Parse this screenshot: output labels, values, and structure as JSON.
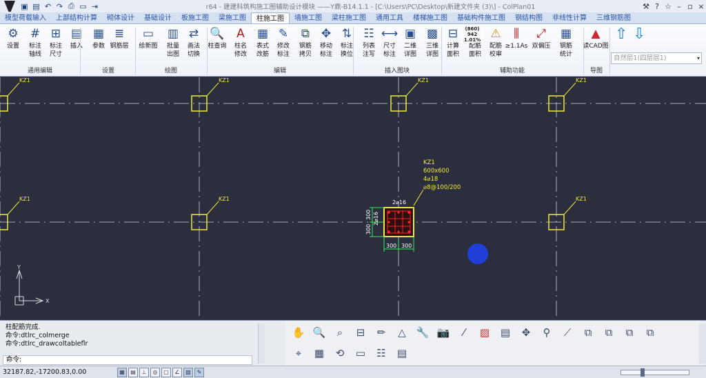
{
  "titlebar": {
    "title": "r64 - 建建科筑构施工图辅助设计模块 ——Y鼎-B14.1.1 - [C:\\Users\\PC\\Desktop\\新建文件夹 (3)\\] - ColPlan01",
    "quick_access": [
      "save-icon",
      "undo-icon",
      "redo-icon",
      "print-icon",
      "open-icon",
      "export-icon"
    ]
  },
  "tabs": [
    {
      "label": "模型荷载输入",
      "active": false
    },
    {
      "label": "上部结构计算",
      "active": false
    },
    {
      "label": "砌体设计",
      "active": false
    },
    {
      "label": "基础设计",
      "active": false
    },
    {
      "label": "板施工图",
      "active": false
    },
    {
      "label": "梁施工图",
      "active": false
    },
    {
      "label": "柱施工图",
      "active": true
    },
    {
      "label": "墙施工图",
      "active": false
    },
    {
      "label": "梁柱施工图",
      "active": false
    },
    {
      "label": "通用工具",
      "active": false
    },
    {
      "label": "楼梯施工图",
      "active": false
    },
    {
      "label": "基础构件施工图",
      "active": false
    },
    {
      "label": "钢结构图",
      "active": false
    },
    {
      "label": "非线性计算",
      "active": false
    },
    {
      "label": "三维钢筋图",
      "active": false
    }
  ],
  "ribbon": {
    "buttons": [
      {
        "label": "设置",
        "icon": "settings-icon"
      },
      {
        "label": "标注\n轴线",
        "icon": "axis-grid-icon"
      },
      {
        "label": "标注\n尺寸",
        "icon": "dimension-grid-icon"
      },
      {
        "label": "插入",
        "icon": "insert-icon"
      },
      {
        "label": "参数",
        "icon": "parameter-icon"
      },
      {
        "label": "钢筋层",
        "icon": "rebar-layer-icon"
      },
      {
        "label": "绘新图",
        "icon": "new-drawing-icon"
      },
      {
        "label": "批量\n出图",
        "icon": "batch-output-icon"
      },
      {
        "label": "画法\n切换",
        "icon": "switch-method-icon"
      },
      {
        "label": "柱查询",
        "icon": "column-query-icon"
      },
      {
        "label": "柱名\n修改",
        "icon": "rename-column-icon"
      },
      {
        "label": "表式\n改筋",
        "icon": "table-rebar-icon"
      },
      {
        "label": "修改\n标注",
        "icon": "edit-annotation-icon"
      },
      {
        "label": "钢筋\n拷贝",
        "icon": "rebar-copy-icon"
      },
      {
        "label": "移动\n标注",
        "icon": "move-annotation-icon"
      },
      {
        "label": "标注\n换位",
        "icon": "swap-annotation-icon"
      },
      {
        "label": "列表\n注写",
        "icon": "list-annotation-icon"
      },
      {
        "label": "尺寸\n标注",
        "icon": "dimension-icon"
      },
      {
        "label": "二维\n详图",
        "icon": "2d-detail-icon"
      },
      {
        "label": "三维\n详图",
        "icon": "3d-detail-icon"
      },
      {
        "label": "计算\n面积",
        "icon": "calc-area-icon"
      },
      {
        "label": "配筋\n面积",
        "icon": "rebar-area-icon"
      },
      {
        "label": "配筋\n校审",
        "icon": "rebar-check-icon"
      },
      {
        "label": "≥1.1As",
        "icon": "ratio-icon"
      },
      {
        "label": "双偏压",
        "icon": "biaxial-icon"
      },
      {
        "label": "钢筋\n统计",
        "icon": "rebar-stats-icon"
      },
      {
        "label": "读CAD图",
        "icon": "read-cad-icon"
      }
    ],
    "groups": [
      "通用编辑",
      "设置",
      "绘图",
      "编辑",
      "插入图块",
      "辅助功能",
      "导图"
    ],
    "ratio_text": [
      "(860)",
      "942",
      "1.01%"
    ],
    "floor_select": "自然层1(四层层1)"
  },
  "canvas": {
    "column_label": "KZ1",
    "main_column": {
      "name": "KZ1",
      "size": "600x600",
      "corner_bars": "4⌀18",
      "stirrups": "⌀8@100/200",
      "top_bars": "2⌀16",
      "side_bars": "2⌀16",
      "dim_left_1": "300",
      "dim_left_2": "300",
      "dim_bottom_1": "300",
      "dim_bottom_2": "300"
    },
    "ucs_x": "X",
    "ucs_y": "Y"
  },
  "command": {
    "history": [
      "柱配筋完成.",
      "命令:dtlrc_colmerge",
      "命令:dtlrc_drawcoltableflr"
    ],
    "prompt": "命令:"
  },
  "status": {
    "coords": "32187.82,-17200.83,0.00"
  }
}
